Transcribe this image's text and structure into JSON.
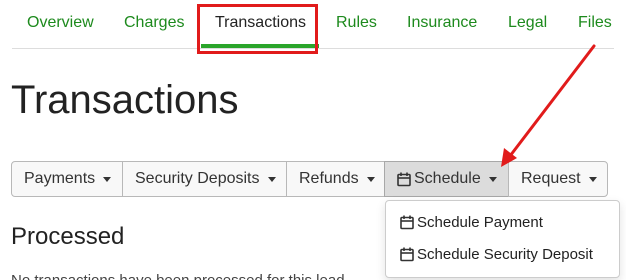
{
  "tabs": [
    {
      "label": "Overview"
    },
    {
      "label": "Charges"
    },
    {
      "label": "Transactions",
      "active": true
    },
    {
      "label": "Rules"
    },
    {
      "label": "Insurance"
    },
    {
      "label": "Legal"
    },
    {
      "label": "Files"
    }
  ],
  "page_title": "Transactions",
  "buttons": {
    "payments": "Payments",
    "security_deposits": "Security Deposits",
    "refunds": "Refunds",
    "schedule": "Schedule",
    "request": "Request"
  },
  "schedule_menu": {
    "items": [
      {
        "label": "Schedule Payment",
        "icon": "calendar-icon"
      },
      {
        "label": "Schedule Security Deposit",
        "icon": "calendar-icon"
      }
    ]
  },
  "processed": {
    "title": "Processed",
    "empty_text": "No transactions have been processed for this lead"
  },
  "colors": {
    "tab_link": "#1d8a1d",
    "active_underline": "#2aa52a",
    "annotation": "#e11b1b"
  }
}
